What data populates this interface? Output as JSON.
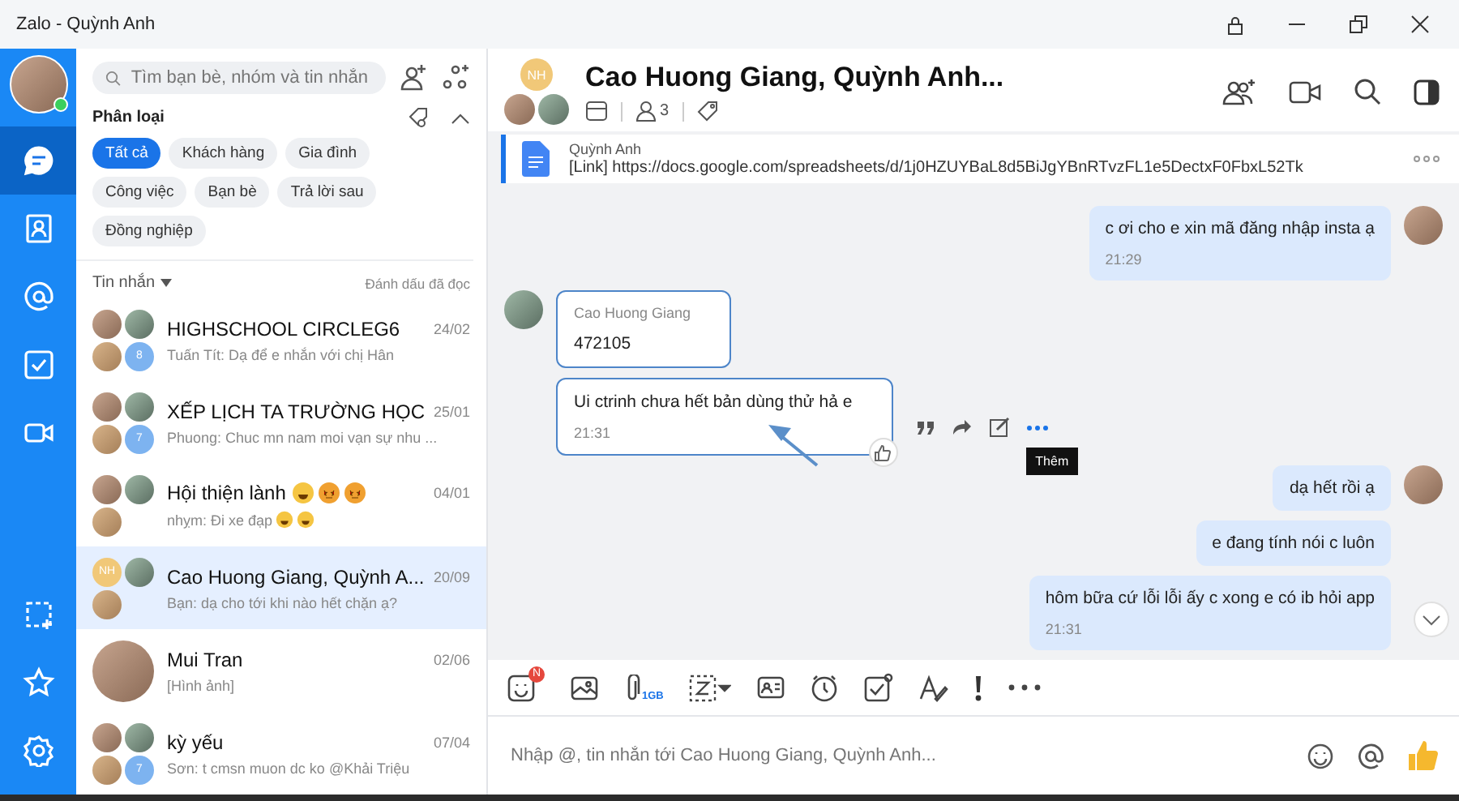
{
  "window": {
    "title": "Zalo - Quỳnh Anh"
  },
  "nav": {
    "top": [
      {
        "kind": "chat",
        "selected": true
      },
      {
        "kind": "contacts",
        "selected": false
      },
      {
        "kind": "mention",
        "selected": false
      },
      {
        "kind": "todo",
        "selected": false
      },
      {
        "kind": "video",
        "selected": false
      }
    ],
    "bottom": [
      {
        "kind": "capture",
        "selected": false
      },
      {
        "kind": "star",
        "selected": false
      },
      {
        "kind": "settings",
        "selected": false
      }
    ]
  },
  "sidebar": {
    "search": {
      "placeholder": "Tìm bạn bè, nhóm và tin nhắn"
    },
    "filter_title": "Phân loại",
    "chips": [
      {
        "label": "Tất cả",
        "selected": true
      },
      {
        "label": "Khách hàng",
        "selected": false
      },
      {
        "label": "Gia đình",
        "selected": false
      },
      {
        "label": "Công việc",
        "selected": false
      },
      {
        "label": "Bạn bè",
        "selected": false
      },
      {
        "label": "Trả lời sau",
        "selected": false
      },
      {
        "label": "Đồng nghiệp",
        "selected": false
      }
    ],
    "list_title": "Tin nhắn",
    "mark_read": "Đánh dấu đã đọc",
    "conversations": [
      {
        "kind": "group",
        "name": "HIGHSCHOOL CIRCLEG6",
        "time": "24/02",
        "preview": "Tuấn Tít: Dạ để e nhắn với chị Hân",
        "more_count": "8",
        "selected": false
      },
      {
        "kind": "group",
        "name": "XẾP LỊCH TA TRƯỜNG HỌC",
        "time": "25/01",
        "preview": "Phuong: Chuc mn nam moi vạn sự nhu ...",
        "more_count": "7",
        "selected": false
      },
      {
        "kind": "group",
        "name": "Hội thiện lành",
        "name_emojis": [
          {
            "kind": "laughing"
          },
          {
            "kind": "starstruck"
          },
          {
            "kind": "starstruck"
          }
        ],
        "time": "04/01",
        "preview": "nhỵm: Đi xe đạp",
        "preview_emojis": [
          {
            "kind": "laughing"
          },
          {
            "kind": "laughing"
          }
        ],
        "selected": false
      },
      {
        "kind": "group",
        "name": "Cao Huong Giang, Quỳnh A...",
        "initials": "NH",
        "time": "20/09",
        "preview": "Bạn: dạ cho tới khi nào hết chặn ạ?",
        "selected": true
      },
      {
        "kind": "single",
        "name": "Mui Tran",
        "time": "02/06",
        "preview": "[Hình ảnh]",
        "selected": false
      },
      {
        "kind": "group",
        "name": "kỳ yếu",
        "time": "07/04",
        "preview": "Sơn: t cmsn muon dc ko @Khải Triệu",
        "more_count": "7",
        "selected": false
      }
    ]
  },
  "chat": {
    "initials": "NH",
    "title": "Cao Huong Giang, Quỳnh Anh...",
    "member_count": "3",
    "pinned": {
      "sender": "Quỳnh Anh",
      "text": "[Link] https://docs.google.com/spreadsheets/d/1j0HZUYBaL8d5BiJgYBnRTvzFL1e5DectxF0FbxL52Tk"
    },
    "messages": [
      {
        "kind": "sent",
        "text": "c ơi cho e xin mã đăng nhập insta ạ",
        "time": "21:29",
        "avatar": true
      },
      {
        "kind": "received",
        "sender": "Cao Huong Giang",
        "text": "472105",
        "avatar": true
      },
      {
        "kind": "received",
        "text": "Ui ctrinh chưa hết bản dùng thử hả e",
        "time": "21:31",
        "avatar": false,
        "tooltip": "Thêm"
      },
      {
        "kind": "sent",
        "text": "dạ hết rồi ạ",
        "avatar": true
      },
      {
        "kind": "sent",
        "text": "e đang tính nói c luôn",
        "avatar": false
      },
      {
        "kind": "sent",
        "text": "hôm bữa cứ lỗi lỗi ấy c xong e có ib hỏi app",
        "time": "21:31",
        "avatar": false
      }
    ],
    "toolbar": {
      "sticker_badge": "N",
      "file_size": "1GB"
    },
    "input": {
      "placeholder": "Nhập @, tin nhắn tới Cao Huong Giang, Quỳnh Anh..."
    }
  }
}
